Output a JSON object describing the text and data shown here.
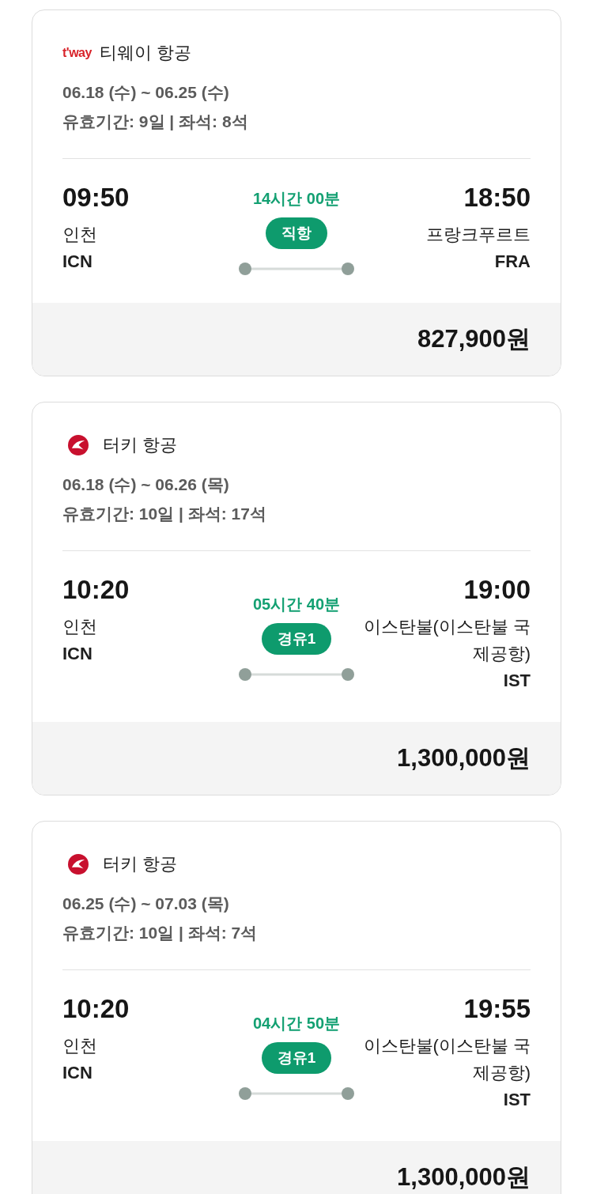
{
  "flights": [
    {
      "airline": {
        "name": "티웨이 항공",
        "logo": {
          "kind": "wordmark",
          "text": "t'way"
        }
      },
      "dates": "06.18 (수) ~ 06.25 (수)",
      "validity": "유효기간: 9일 | 좌석: 8석",
      "departure": {
        "time": "09:50",
        "city": "인천",
        "code": "ICN"
      },
      "duration": "14시간 00분",
      "stops": "직항",
      "arrival": {
        "time": "18:50",
        "city": "프랑크푸르트",
        "code": "FRA"
      },
      "price": "827,900원"
    },
    {
      "airline": {
        "name": "터키 항공",
        "logo": {
          "kind": "emblem"
        }
      },
      "dates": "06.18 (수) ~ 06.26 (목)",
      "validity": "유효기간: 10일 | 좌석: 17석",
      "departure": {
        "time": "10:20",
        "city": "인천",
        "code": "ICN"
      },
      "duration": "05시간 40분",
      "stops": "경유1",
      "arrival": {
        "time": "19:00",
        "city": "이스탄불(이스탄불 국제공항)",
        "code": "IST"
      },
      "price": "1,300,000원"
    },
    {
      "airline": {
        "name": "터키 항공",
        "logo": {
          "kind": "emblem"
        }
      },
      "dates": "06.25 (수) ~ 07.03 (목)",
      "validity": "유효기간: 10일 | 좌석: 7석",
      "departure": {
        "time": "10:20",
        "city": "인천",
        "code": "ICN"
      },
      "duration": "04시간 50분",
      "stops": "경유1",
      "arrival": {
        "time": "19:55",
        "city": "이스탄불(이스탄불 국제공항)",
        "code": "IST"
      },
      "price": "1,300,000원"
    }
  ]
}
